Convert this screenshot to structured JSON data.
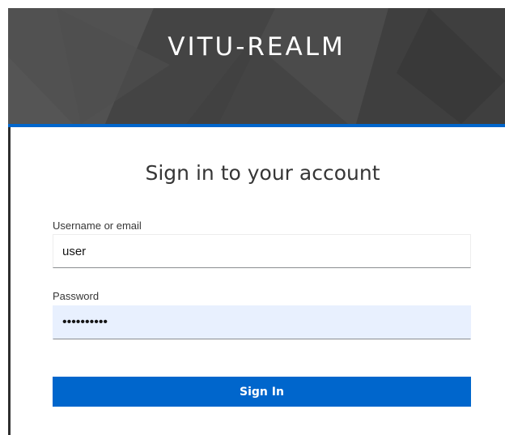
{
  "header": {
    "realm_title": "VITU-REALM"
  },
  "login": {
    "title": "Sign in to your account",
    "username_label": "Username or email",
    "username_value": "user",
    "password_label": "Password",
    "password_value": "••••••••••",
    "signin_label": "Sign In"
  },
  "colors": {
    "accent": "#0066cc",
    "header_bg": "#4a4a4a",
    "autofill_bg": "#e8f0fe"
  }
}
